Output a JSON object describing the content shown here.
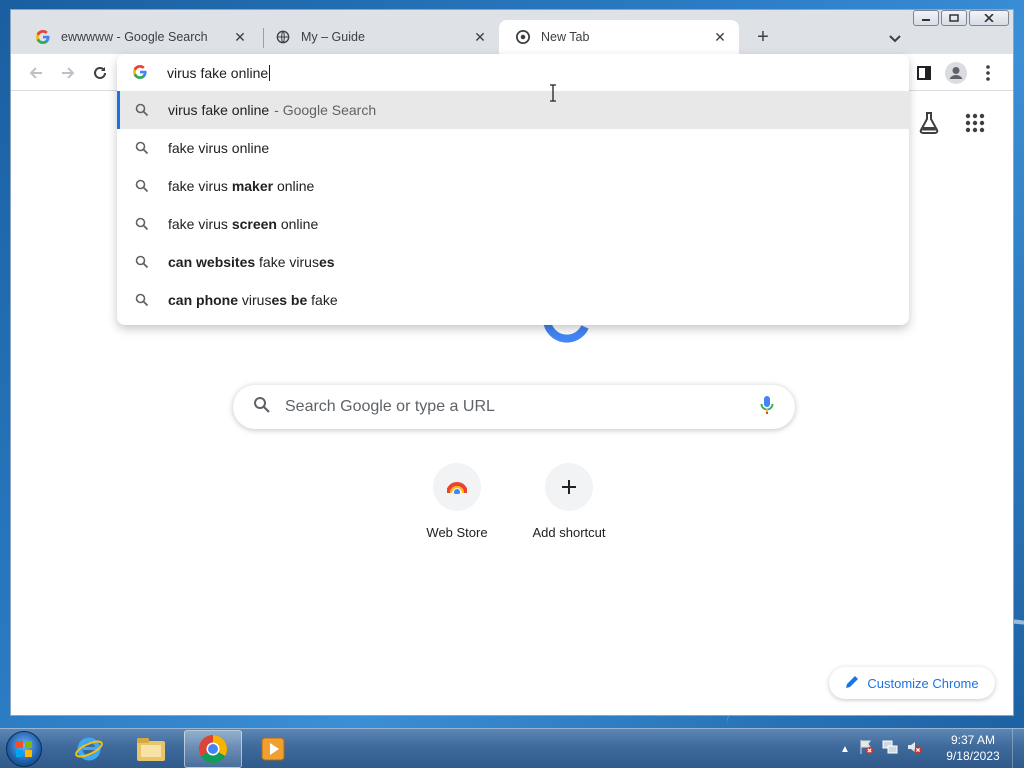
{
  "browser": {
    "tabs": [
      {
        "title": "ewwwww - Google Search",
        "icon": "google-g-icon"
      },
      {
        "title": "My – Guide",
        "icon": "globe-icon"
      },
      {
        "title": "New Tab",
        "icon": "chrome-icon"
      }
    ],
    "active_tab": 2
  },
  "omnibox": {
    "input_value": "virus fake online",
    "suggestions": [
      {
        "parts": [
          {
            "text": "virus fake online",
            "bold": false
          }
        ],
        "description": "- Google Search",
        "selected": true
      },
      {
        "parts": [
          {
            "text": "fake virus online",
            "bold": false
          }
        ]
      },
      {
        "parts": [
          {
            "text": "fake virus ",
            "bold": false
          },
          {
            "text": "maker",
            "bold": true
          },
          {
            "text": " online",
            "bold": false
          }
        ]
      },
      {
        "parts": [
          {
            "text": "fake virus ",
            "bold": false
          },
          {
            "text": "screen",
            "bold": true
          },
          {
            "text": " online",
            "bold": false
          }
        ]
      },
      {
        "parts": [
          {
            "text": "can websites",
            "bold": true
          },
          {
            "text": " fake virus",
            "bold": false
          },
          {
            "text": "es",
            "bold": true
          }
        ]
      },
      {
        "parts": [
          {
            "text": "can phone",
            "bold": true
          },
          {
            "text": " virus",
            "bold": false
          },
          {
            "text": "es be",
            "bold": true
          },
          {
            "text": " fake",
            "bold": false
          }
        ]
      }
    ]
  },
  "ntp": {
    "search_placeholder": "Search Google or type a URL",
    "shortcuts": [
      {
        "label": "Web Store",
        "icon": "chrome-web-store-icon"
      },
      {
        "label": "Add shortcut",
        "icon": "plus-icon"
      }
    ],
    "customize_label": "Customize Chrome"
  },
  "taskbar": {
    "apps": [
      "internet-explorer-icon",
      "file-explorer-icon",
      "chrome-icon",
      "media-player-icon"
    ],
    "active_app": "chrome-icon",
    "time": "9:37 AM",
    "date": "9/18/2023"
  },
  "colors": {
    "accent": "#1a73e8",
    "selected_row": "#e8e8e8",
    "tab_strip": "#dee1e6"
  }
}
